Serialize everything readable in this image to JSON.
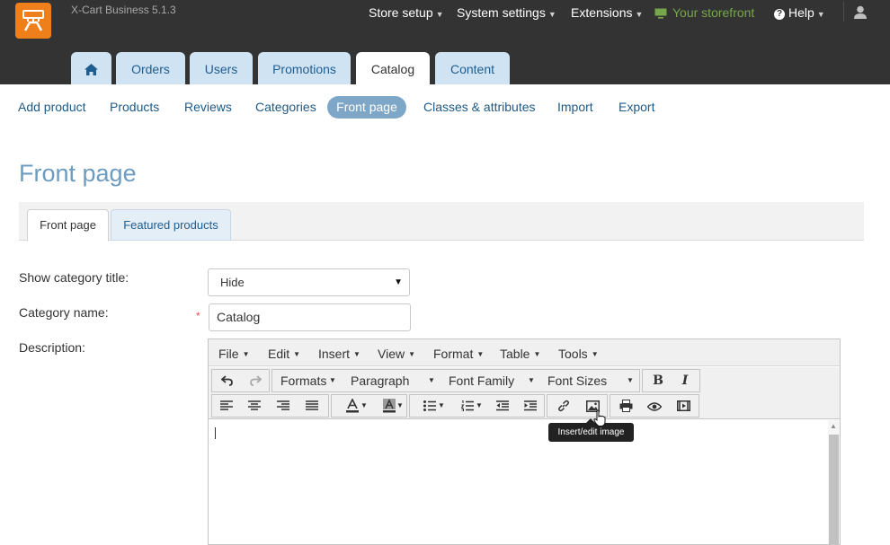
{
  "header": {
    "app_version": "X-Cart Business 5.1.3",
    "nav": {
      "store_setup": "Store setup",
      "system_settings": "System settings",
      "extensions": "Extensions",
      "your_storefront": "Your storefront",
      "help": "Help"
    },
    "caret": "⌄"
  },
  "main_tabs": {
    "orders": "Orders",
    "users": "Users",
    "promotions": "Promotions",
    "catalog": "Catalog",
    "content": "Content"
  },
  "subnav": {
    "add_product": "Add product",
    "products": "Products",
    "reviews": "Reviews",
    "categories": "Categories",
    "front_page": "Front page",
    "classes_attributes": "Classes & attributes",
    "import": "Import",
    "export": "Export"
  },
  "page_title": "Front page",
  "page_tabs": {
    "front_page": "Front page",
    "featured_products": "Featured products"
  },
  "form": {
    "show_category_title_label": "Show category title:",
    "show_category_title_value": "Hide",
    "category_name_label": "Category name:",
    "category_name_value": "Catalog",
    "required_mark": "*",
    "description_label": "Description:"
  },
  "editor": {
    "menu": {
      "file": "File",
      "edit": "Edit",
      "insert": "Insert",
      "view": "View",
      "format": "Format",
      "table": "Table",
      "tools": "Tools"
    },
    "toolbar": {
      "formats": "Formats",
      "paragraph": "Paragraph",
      "font_family": "Font Family",
      "font_sizes": "Font Sizes",
      "bold": "B",
      "italic": "I"
    },
    "tooltip": "Insert/edit image"
  },
  "colors": {
    "header_bg": "#333333",
    "logo_orange": "#ef7f1a",
    "storefront_green": "#78a64b",
    "tab_blue": "#cfe3f3",
    "link_blue": "#1e5a87",
    "active_pill": "#7ea6c6",
    "title_blue": "#6d9cc0"
  },
  "icons": [
    "home-icon",
    "monitor-icon",
    "help-icon",
    "user-icon",
    "undo-icon",
    "redo-icon",
    "link-icon",
    "image-icon",
    "print-icon",
    "preview-icon",
    "media-icon"
  ]
}
